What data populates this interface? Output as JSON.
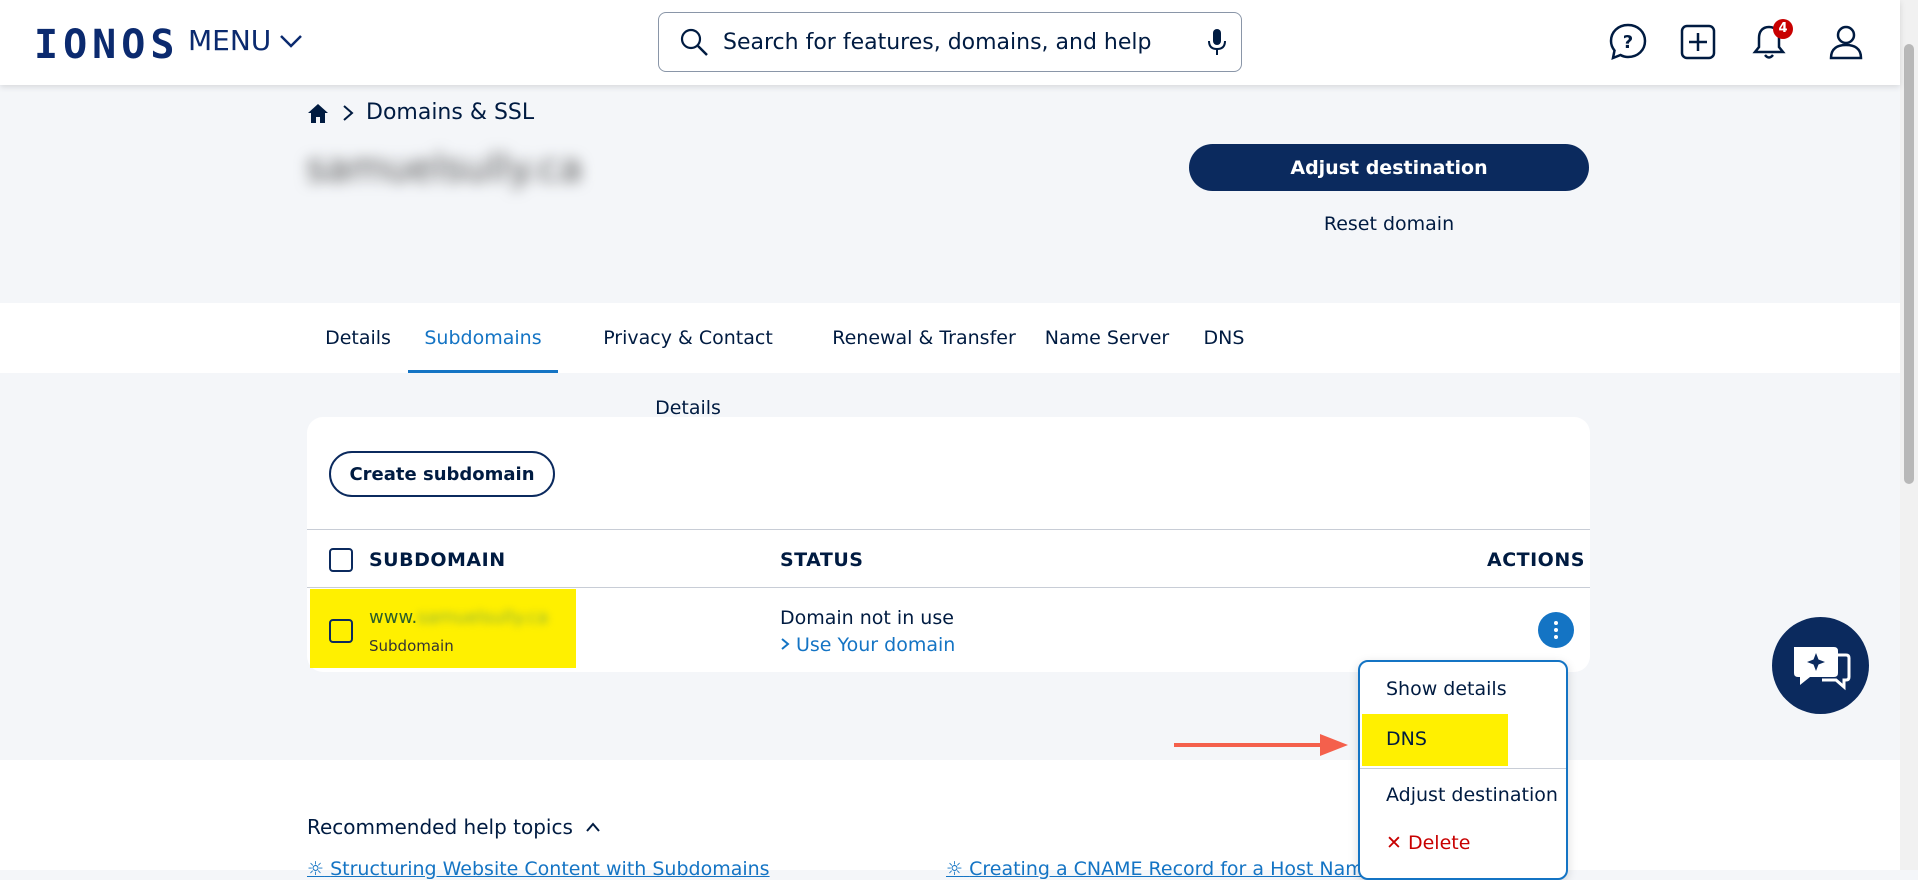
{
  "header": {
    "logo_text": "IONOS",
    "menu_label": "MENU",
    "search_placeholder": "Search for features, domains, and help",
    "notification_count": "4",
    "icons": [
      "help-chat-icon",
      "add-icon",
      "bell-icon",
      "user-icon",
      "search-icon",
      "mic-icon"
    ]
  },
  "breadcrumb": {
    "current": "Domains & SSL"
  },
  "domain": {
    "name": "samuelsully.ca",
    "adjust_destination": "Adjust destination",
    "reset_domain": "Reset domain"
  },
  "tabs": [
    {
      "label": "Details"
    },
    {
      "label": "Subdomains",
      "active": true
    },
    {
      "label": "Privacy & Contact Details"
    },
    {
      "label": "Renewal & Transfer"
    },
    {
      "label": "Name Server"
    },
    {
      "label": "DNS"
    }
  ],
  "subdomains": {
    "create_button": "Create subdomain",
    "columns": {
      "subdomain": "SUBDOMAIN",
      "status": "STATUS",
      "actions": "ACTIONS"
    },
    "rows": [
      {
        "name_prefix": "www.",
        "name_rest": "samuelsully.ca",
        "type": "Subdomain",
        "status": "Domain not in use",
        "status_link": "Use Your domain"
      }
    ]
  },
  "actions_menu": {
    "items": [
      "Show details",
      "DNS",
      "Adjust destination"
    ],
    "delete": "Delete",
    "highlighted": "DNS"
  },
  "help": {
    "title": "Recommended help topics",
    "links": [
      "Structuring Website Content with Subdomains",
      "Creating a CNAME Record for a Host Name"
    ]
  },
  "colors": {
    "brand": "#0b2a6f",
    "accent": "#1474c4",
    "highlight": "#fff000",
    "arrow": "#f4604c",
    "danger": "#c80000"
  }
}
